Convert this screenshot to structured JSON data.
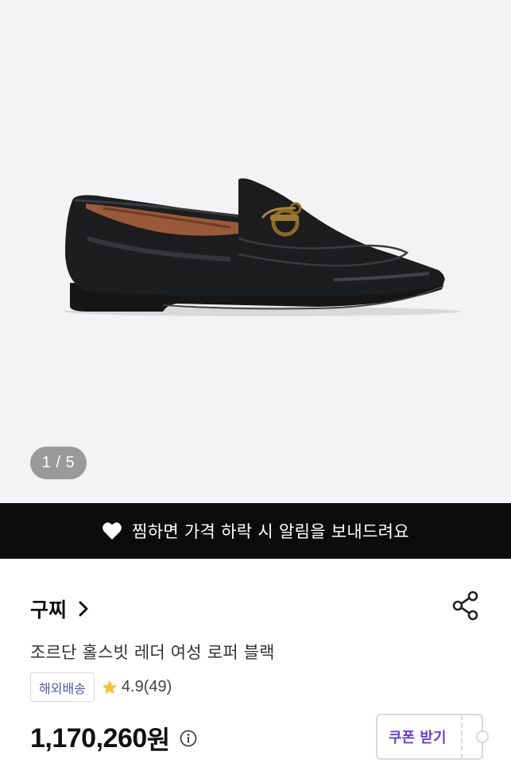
{
  "gallery": {
    "image_alt": "loafer-photo",
    "current_page": 1,
    "total_pages": 5,
    "indicator_text": "1 / 5"
  },
  "wish_bar": {
    "icon": "heart-icon",
    "text": "찜하면 가격 하락 시 알림을 보내드려요"
  },
  "product": {
    "brand": "구찌",
    "title": "조르단 홀스빗 레더 여성 로퍼 블랙",
    "badge": "해외배송",
    "rating": "4.9(49)",
    "price": "1,170,260",
    "price_unit": "원",
    "coupon_label": "쿠폰 받기"
  },
  "colors": {
    "coupon_text": "#6b3fd1",
    "badge_text": "#4a5ea8",
    "star": "#f6c331",
    "wish_bar_bg": "#0c0c0c"
  }
}
